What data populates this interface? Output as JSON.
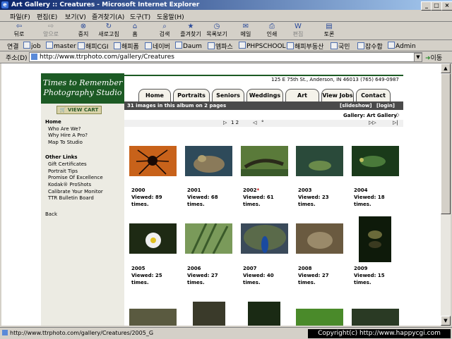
{
  "window": {
    "title": "Art Gallery :: Creatures - Microsoft Internet Explorer"
  },
  "menu": [
    "파일(F)",
    "편집(E)",
    "보기(V)",
    "즐겨찾기(A)",
    "도구(T)",
    "도움말(H)"
  ],
  "toolbar": [
    "뒤로",
    "앞으로",
    "중지",
    "새로고침",
    "홈",
    "검색",
    "즐겨찾기",
    "목록보기",
    "메일",
    "인쇄",
    "편집",
    "토론"
  ],
  "links": {
    "label": "연결",
    "items": [
      "job",
      "master",
      "해피CGI",
      "해피폼",
      "네이버",
      "Daum",
      "엠파스",
      "PHPSCHOOL",
      "해피부동산",
      "국민",
      "잡수합",
      "Admin"
    ]
  },
  "address": {
    "label": "주소(D)",
    "url": "http://www.ttrphoto.com/gallery/Creatures",
    "go": "이동"
  },
  "site": {
    "logo_line1": "Times to Remember",
    "logo_line2": "Photography Studio",
    "address": "125  E 75th St., Anderson, IN 46013   (765) 649-0987",
    "nav": [
      "Home",
      "Portraits",
      "Seniors",
      "Weddings",
      "Art",
      "View Jobs",
      "Contact Us"
    ],
    "album_info": "31 images in this album on 2 pages",
    "slideshow": "[slideshow]",
    "login": "[login]",
    "breadcrumb": "Gallery: Art Gallery",
    "pager": "1 2",
    "view_cart": "VIEW CART",
    "sidebar": {
      "home": "Home",
      "home_items": [
        "Who Are We?",
        "Why Hire A Pro?",
        "Map To Studio"
      ],
      "other_title": "Other Links",
      "other_items": [
        "Gift Certificates",
        "Portrait Tips",
        "Promise Of Excellence",
        "Kodak® ProShots",
        "Calibrate Your Monitor",
        "TTR Bulletin Board"
      ],
      "back": "Back"
    },
    "thumbs": [
      {
        "id": "2000",
        "viewed": "Viewed: 89",
        "times": "times.",
        "color": "#c8621a"
      },
      {
        "id": "2001",
        "viewed": "Viewed: 68",
        "times": "times.",
        "color": "#3a5a6a"
      },
      {
        "id": "2002",
        "viewed": "Viewed: 61",
        "times": "times.",
        "color": "#4a6a3a",
        "star": "*"
      },
      {
        "id": "2003",
        "viewed": "Viewed: 23",
        "times": "times.",
        "color": "#2a4a3a"
      },
      {
        "id": "2004",
        "viewed": "Viewed: 18",
        "times": "times.",
        "color": "#1a3a1a"
      },
      {
        "id": "2005",
        "viewed": "Viewed: 25",
        "times": "times.",
        "color": "#2a3a20"
      },
      {
        "id": "2006",
        "viewed": "Viewed: 27",
        "times": "times.",
        "color": "#6a8a4a"
      },
      {
        "id": "2007",
        "viewed": "Viewed: 40",
        "times": "times.",
        "color": "#3a4a6a"
      },
      {
        "id": "2008",
        "viewed": "Viewed: 27",
        "times": "times.",
        "color": "#7a6a4a"
      },
      {
        "id": "2009",
        "viewed": "Viewed: 15",
        "times": "times.",
        "color": "#1a2a10"
      }
    ]
  },
  "status": {
    "text": "http://www.ttrphoto.com/gallery/Creatures/2005_G",
    "copyright": "Copyright(c) http://www.happycgi.com"
  }
}
